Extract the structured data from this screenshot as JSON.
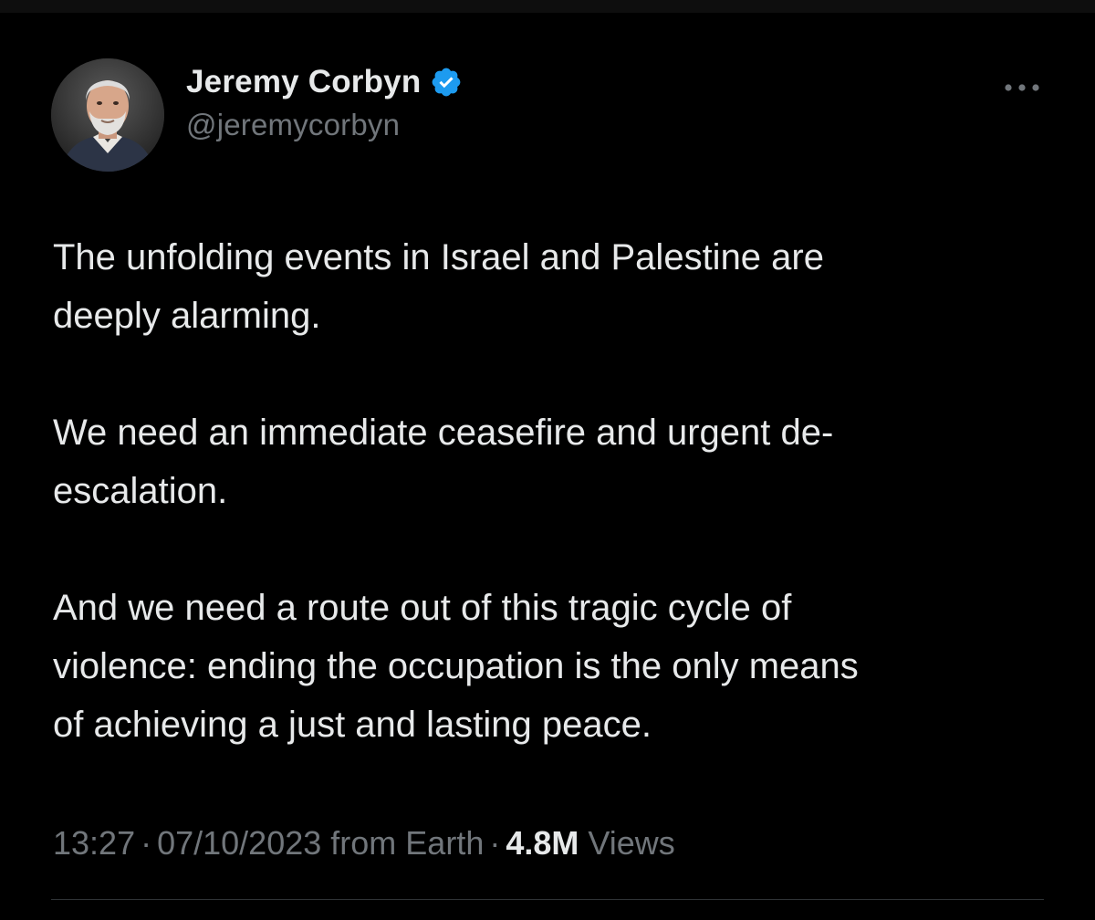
{
  "tweet": {
    "author": {
      "display_name": "Jeremy Corbyn",
      "handle": "@jeremycorbyn",
      "verified": true,
      "verified_icon": "verified-badge-icon",
      "verified_color": "#1d9bf0"
    },
    "more_icon": "more-horizontal-icon",
    "paragraphs": [
      "The unfolding events in Israel and Palestine are\ndeeply alarming.",
      "We need an immediate ceasefire and urgent de-\nescalation.",
      "And we need a route out of this tragic cycle of\nviolence: ending the occupation is the only means\nof achieving a just and lasting peace."
    ],
    "meta": {
      "time": "13:27",
      "date": "07/10/2023",
      "source": "from Earth",
      "separator": "·",
      "views_count": "4.8M",
      "views_label": "Views"
    }
  },
  "colors": {
    "background": "#000000",
    "text_primary": "#e7e9ea",
    "text_secondary": "#71767b",
    "divider": "#2f3336",
    "accent": "#1d9bf0"
  }
}
